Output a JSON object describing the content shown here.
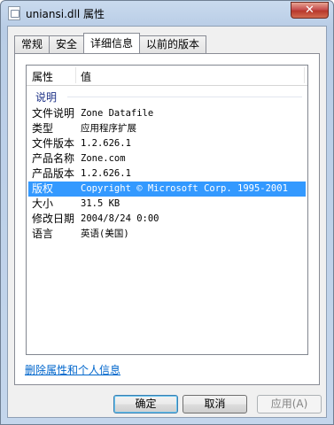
{
  "window": {
    "title": "uniansi.dll 属性",
    "close_label": "✕"
  },
  "tabs": [
    {
      "label": "常规",
      "active": false
    },
    {
      "label": "安全",
      "active": false
    },
    {
      "label": "详细信息",
      "active": true
    },
    {
      "label": "以前的版本",
      "active": false
    }
  ],
  "details": {
    "columns": {
      "property": "属性",
      "value": "值"
    },
    "group_label": "说明",
    "rows": [
      {
        "key": "文件说明",
        "value": "Zone Datafile"
      },
      {
        "key": "类型",
        "value": "应用程序扩展"
      },
      {
        "key": "文件版本",
        "value": "1.2.626.1"
      },
      {
        "key": "产品名称",
        "value": "Zone.com"
      },
      {
        "key": "产品版本",
        "value": "1.2.626.1"
      },
      {
        "key": "版权",
        "value": "Copyright © Microsoft Corp. 1995-2001"
      },
      {
        "key": "大小",
        "value": "31.5 KB"
      },
      {
        "key": "修改日期",
        "value": "2004/8/24 0:00"
      },
      {
        "key": "语言",
        "value": "英语(美国)"
      }
    ],
    "selected_index": 5
  },
  "remove_link": "删除属性和个人信息",
  "buttons": {
    "ok": "确定",
    "cancel": "取消",
    "apply": "应用(A)"
  }
}
